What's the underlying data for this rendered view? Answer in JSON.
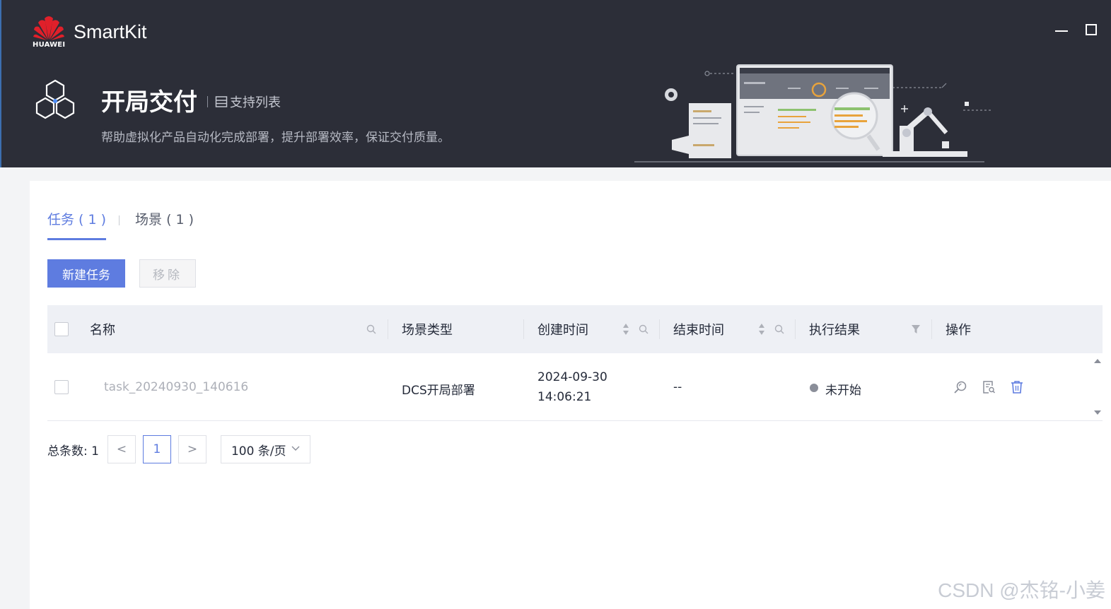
{
  "app": {
    "brand_mark": "HUAWEI",
    "name": "SmartKit"
  },
  "hero": {
    "title": "开局交付",
    "support_link": "支持列表",
    "description": "帮助虚拟化产品自动化完成部署，提升部署效率，保证交付质量。"
  },
  "tabs": [
    {
      "label": "任务 ( 1 )",
      "active": true
    },
    {
      "label": "场景 ( 1 )",
      "active": false
    }
  ],
  "toolbar": {
    "new_task_label": "新建任务",
    "remove_label": "移除"
  },
  "table": {
    "columns": {
      "name": "名称",
      "scene_type": "场景类型",
      "created": "创建时间",
      "ended": "结束时间",
      "result": "执行结果",
      "actions": "操作"
    },
    "rows": [
      {
        "name": "task_20240930_140616",
        "scene_type": "DCS开局部署",
        "created_date": "2024-09-30",
        "created_time": "14:06:21",
        "ended": "--",
        "result": "未开始",
        "result_color": "#8a8e99"
      }
    ]
  },
  "pagination": {
    "total_label": "总条数: 1",
    "prev": "<",
    "current_page": "1",
    "next": ">",
    "page_size": "100 条/页"
  },
  "watermark": "CSDN @杰铭-小姜",
  "colors": {
    "primary": "#5e7ce0",
    "header_bg": "#2c2e38",
    "brand_red": "#e0202a"
  },
  "icons": {
    "brand": "huawei-flower-icon",
    "hero": "hexagon-cluster-icon",
    "support": "list-icon",
    "search": "search-icon",
    "sort": "sort-icon",
    "filter": "filter-icon",
    "view": "view-detail-icon",
    "report": "report-icon",
    "delete": "trash-icon"
  }
}
